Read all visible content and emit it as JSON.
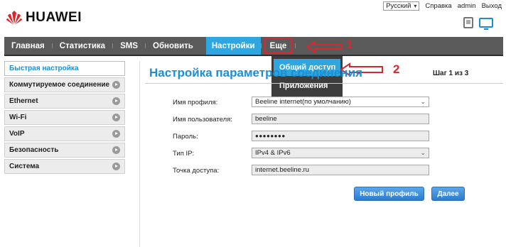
{
  "header": {
    "logo_text": "HUAWEI",
    "language": "Русский",
    "help": "Справка",
    "user": "admin",
    "logout": "Выход"
  },
  "nav": {
    "items": [
      "Главная",
      "Статистика",
      "SMS",
      "Обновить",
      "Настройки",
      "Еще"
    ],
    "active": "Настройки"
  },
  "dropdown": {
    "items": [
      "Общий доступ",
      "Приложения"
    ]
  },
  "annotations": {
    "one": "1",
    "two": "2"
  },
  "sidebar": {
    "items": [
      "Быстрая настройка",
      "Коммутируемое соединение",
      "Ethernet",
      "Wi-Fi",
      "VoIP",
      "Безопасность",
      "Система"
    ]
  },
  "main": {
    "title": "Настройка параметров соединения",
    "step": "Шаг 1 из 3",
    "fields": [
      {
        "label": "Имя профиля:",
        "value": "Beeline internet(по умолчанию)"
      },
      {
        "label": "Имя пользователя:",
        "value": "beeline"
      },
      {
        "label": "Пароль:",
        "value": "●●●●●●●●"
      },
      {
        "label": "Тип IP:",
        "value": "IPv4 & IPv6"
      },
      {
        "label": "Точка доступа:",
        "value": "internet.beeline.ru"
      }
    ],
    "new_profile_button": "Новый профиль",
    "next_button": "Далее"
  },
  "colors": {
    "accent": "#2fa6e0",
    "annotation_red": "#d9272e",
    "nav_bg": "#5a5a5a"
  }
}
